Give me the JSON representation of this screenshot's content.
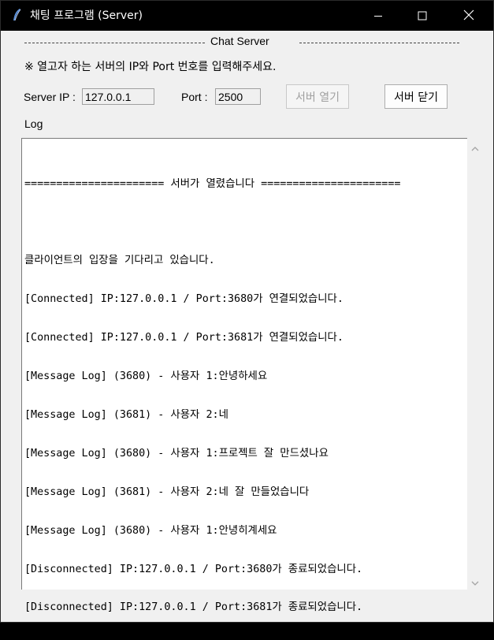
{
  "window": {
    "title": "채팅 프로그램 (Server)"
  },
  "header": {
    "section_title": "Chat Server",
    "notice": "※ 열고자 하는 서버의 IP와 Port 번호를 입력해주세요."
  },
  "form": {
    "server_ip_label": "Server IP :",
    "server_ip_value": "127.0.0.1",
    "port_label": "Port :",
    "port_value": "2500",
    "open_button": "서버 열기",
    "close_button": "서버 닫기"
  },
  "log": {
    "label": "Log",
    "lines": [
      "====================== 서버가 열렸습니다 ======================",
      "",
      "클라이언트의 입장을 기다리고 있습니다.",
      "[Connected] IP:127.0.0.1 / Port:3680가 연결되었습니다.",
      "[Connected] IP:127.0.0.1 / Port:3681가 연결되었습니다.",
      "[Message Log] (3680) - 사용자 1:안녕하세요",
      "[Message Log] (3681) - 사용자 2:네",
      "[Message Log] (3680) - 사용자 1:프로젝트 잘 만드셨나요",
      "[Message Log] (3681) - 사용자 2:네 잘 만들었습니다",
      "[Message Log] (3680) - 사용자 1:안녕히계세요",
      "[Disconnected] IP:127.0.0.1 / Port:3680가 종료되었습니다.",
      "[Disconnected] IP:127.0.0.1 / Port:3681가 종료되었습니다."
    ]
  },
  "icons": {
    "app": "feather-icon",
    "minimize": "minimize-icon",
    "maximize": "maximize-icon",
    "close": "close-icon",
    "scroll_up": "chevron-up-icon",
    "scroll_down": "chevron-down-icon"
  },
  "colors": {
    "titlebar": "#000000",
    "window_bg": "#f0f0f0",
    "log_bg": "#ffffff",
    "disabled_text": "#a0a0a0"
  }
}
